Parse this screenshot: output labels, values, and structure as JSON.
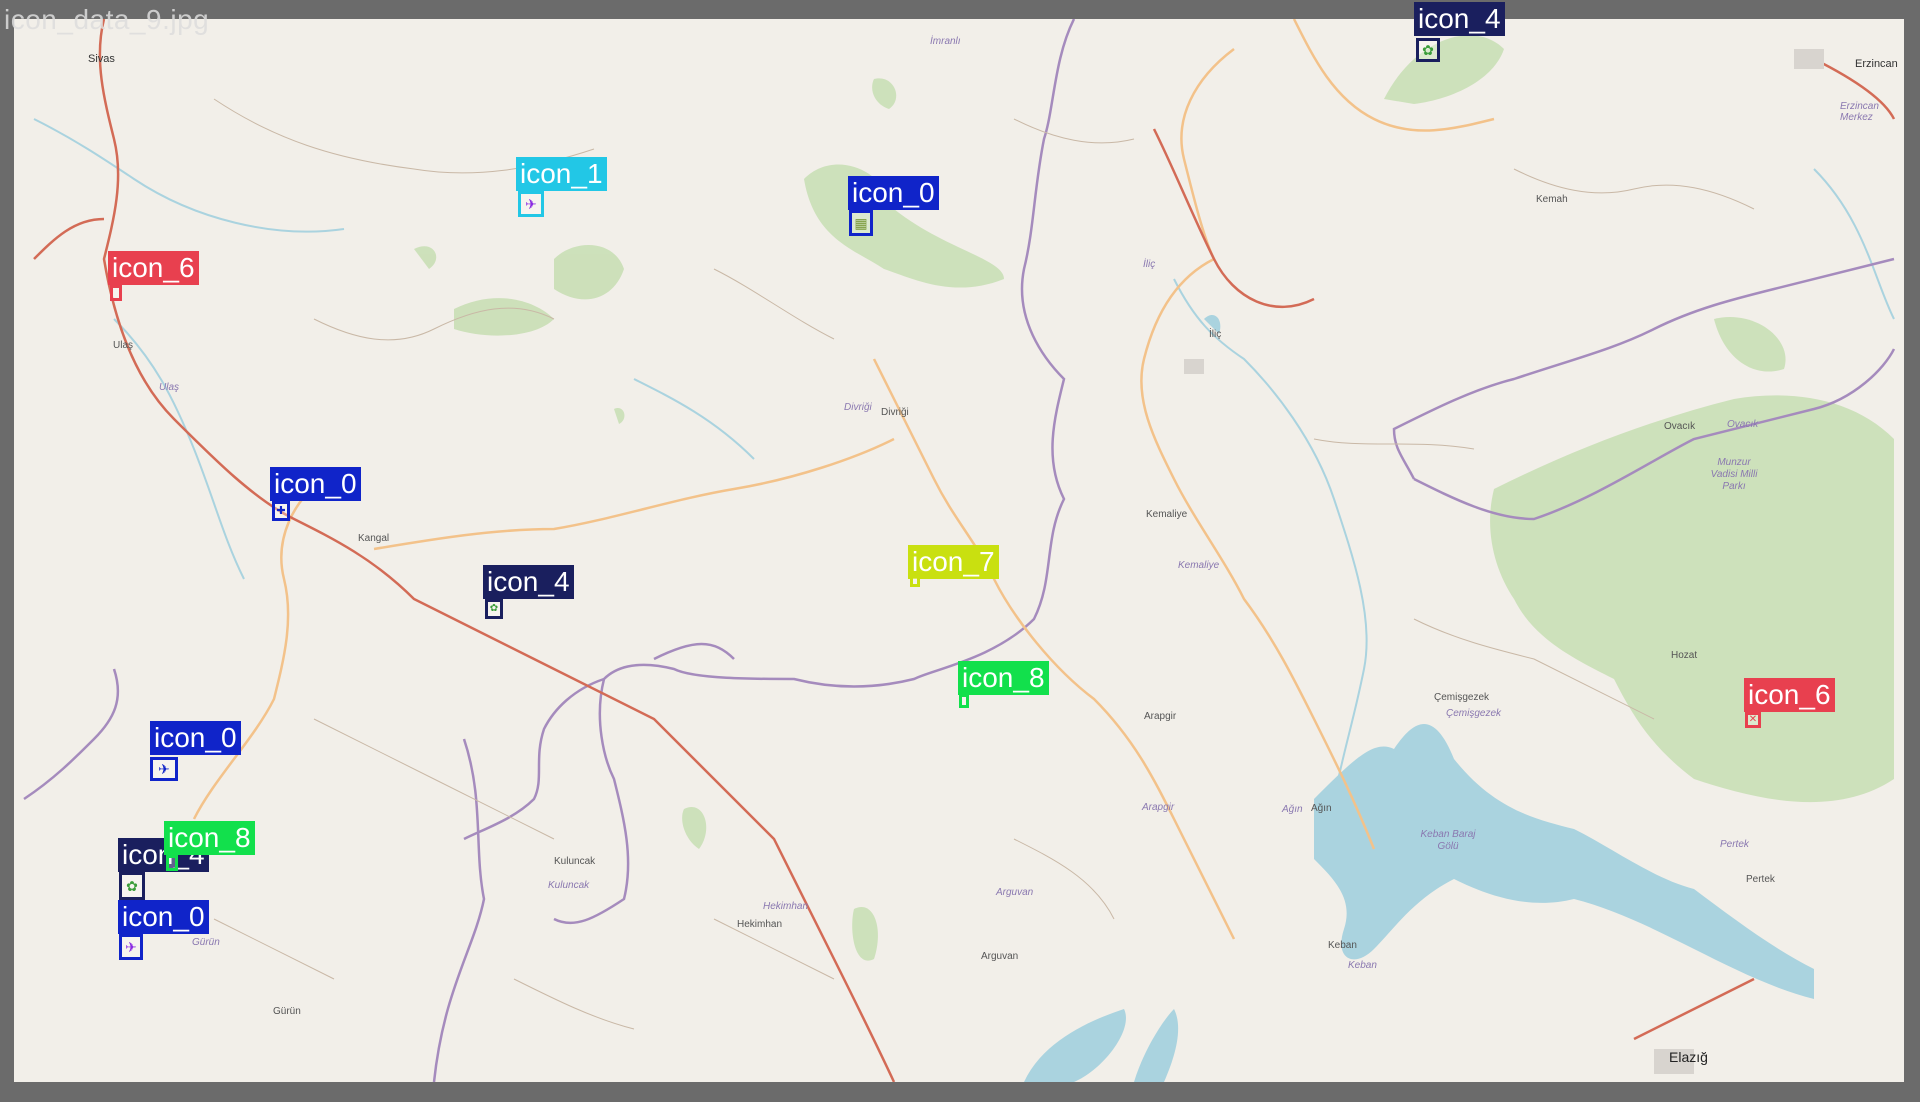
{
  "title": "icon_data_9.jpg",
  "colors": {
    "frame": "#6b6b6b",
    "land": "#f2efe9",
    "water": "#aad3df",
    "forest": "#add19e",
    "admin_border": "#9e7bb3",
    "road_major": "#f6c58a",
    "road_minor": "#d9b08c",
    "road_red": "#d36b56"
  },
  "places": {
    "sivas": "Sivas",
    "imranli": "İmranlı",
    "erzincan": "Erzincan",
    "erzincan_merkez": "Erzincan Merkez",
    "kemah": "Kemah",
    "ilic": "İliç",
    "ilic_river": "İliç",
    "ulas": "Ulaş",
    "ulas_italic": "Ulaş",
    "divrigi": "Divriği",
    "divrigi_italic": "Divriği",
    "ovacik": "Ovacık",
    "ovacik_italic": "Ovacık",
    "munzur": "Munzur Vadisi Milli Parkı",
    "kangal": "Kangal",
    "kemaliye": "Kemaliye",
    "kemaliye_italic": "Kemaliye",
    "hozat": "Hozat",
    "cemisgezek": "Çemişgezek",
    "cemisgezek_italic": "Çemişgezek",
    "arapgir": "Arapgir",
    "arapgir_italic": "Arapgir",
    "agin": "Ağın",
    "agin_italic": "Ağın",
    "keban_baraj": "Keban Baraj Gölü",
    "pertek": "Pertek",
    "pertek_italic": "Pertek",
    "kuluncak": "Kuluncak",
    "kuluncak_italic": "Kuluncak",
    "hekimhan": "Hekimhan",
    "hekimhan_italic": "Hekimhan",
    "arguvan": "Arguvan",
    "arguvan_italic": "Arguvan",
    "gurun": "Gürün",
    "gurun_italic": "Gürün",
    "keban": "Keban",
    "keban_italic": "Keban",
    "elazig": "Elazığ"
  },
  "annotations": [
    {
      "label": "icon_4",
      "color": "#1a1f5e",
      "icon": "farm-icon"
    },
    {
      "label": "icon_1",
      "color": "#22c7e6",
      "icon": "airplane-icon"
    },
    {
      "label": "icon_0",
      "color": "#1024c9",
      "icon": "grid-icon"
    },
    {
      "label": "icon_6",
      "color": "#e8404f",
      "icon": "marker-icon"
    },
    {
      "label": "icon_0",
      "color": "#1024c9",
      "icon": "hospital-icon"
    },
    {
      "label": "icon_4",
      "color": "#1a1f5e",
      "icon": "farm-icon"
    },
    {
      "label": "icon_7",
      "color": "#c9e010",
      "icon": "marker-icon"
    },
    {
      "label": "icon_8",
      "color": "#12e04c",
      "icon": "marker-icon"
    },
    {
      "label": "icon_6",
      "color": "#e8404f",
      "icon": "cross-icon"
    },
    {
      "label": "icon_0",
      "color": "#1024c9",
      "icon": "airplane-icon"
    },
    {
      "label": "icon_4",
      "color": "#1a1f5e",
      "icon": "farm-icon"
    },
    {
      "label": "icon_8",
      "color": "#12e04c",
      "icon": "marker-icon"
    },
    {
      "label": "icon_0",
      "color": "#1024c9",
      "icon": "airplane-icon"
    }
  ]
}
